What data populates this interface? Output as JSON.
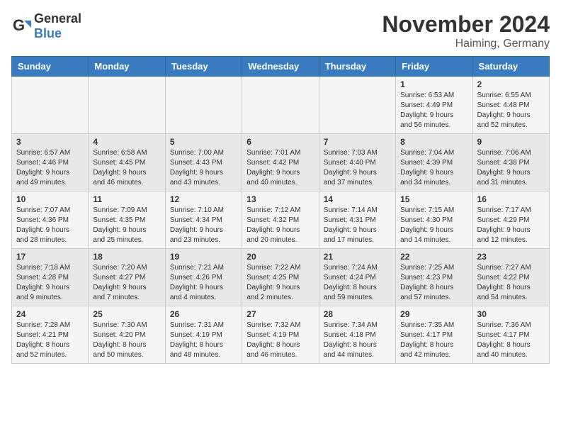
{
  "header": {
    "logo_general": "General",
    "logo_blue": "Blue",
    "month_title": "November 2024",
    "location": "Haiming, Germany"
  },
  "days_of_week": [
    "Sunday",
    "Monday",
    "Tuesday",
    "Wednesday",
    "Thursday",
    "Friday",
    "Saturday"
  ],
  "weeks": [
    [
      {
        "day": "",
        "info": ""
      },
      {
        "day": "",
        "info": ""
      },
      {
        "day": "",
        "info": ""
      },
      {
        "day": "",
        "info": ""
      },
      {
        "day": "",
        "info": ""
      },
      {
        "day": "1",
        "info": "Sunrise: 6:53 AM\nSunset: 4:49 PM\nDaylight: 9 hours\nand 56 minutes."
      },
      {
        "day": "2",
        "info": "Sunrise: 6:55 AM\nSunset: 4:48 PM\nDaylight: 9 hours\nand 52 minutes."
      }
    ],
    [
      {
        "day": "3",
        "info": "Sunrise: 6:57 AM\nSunset: 4:46 PM\nDaylight: 9 hours\nand 49 minutes."
      },
      {
        "day": "4",
        "info": "Sunrise: 6:58 AM\nSunset: 4:45 PM\nDaylight: 9 hours\nand 46 minutes."
      },
      {
        "day": "5",
        "info": "Sunrise: 7:00 AM\nSunset: 4:43 PM\nDaylight: 9 hours\nand 43 minutes."
      },
      {
        "day": "6",
        "info": "Sunrise: 7:01 AM\nSunset: 4:42 PM\nDaylight: 9 hours\nand 40 minutes."
      },
      {
        "day": "7",
        "info": "Sunrise: 7:03 AM\nSunset: 4:40 PM\nDaylight: 9 hours\nand 37 minutes."
      },
      {
        "day": "8",
        "info": "Sunrise: 7:04 AM\nSunset: 4:39 PM\nDaylight: 9 hours\nand 34 minutes."
      },
      {
        "day": "9",
        "info": "Sunrise: 7:06 AM\nSunset: 4:38 PM\nDaylight: 9 hours\nand 31 minutes."
      }
    ],
    [
      {
        "day": "10",
        "info": "Sunrise: 7:07 AM\nSunset: 4:36 PM\nDaylight: 9 hours\nand 28 minutes."
      },
      {
        "day": "11",
        "info": "Sunrise: 7:09 AM\nSunset: 4:35 PM\nDaylight: 9 hours\nand 25 minutes."
      },
      {
        "day": "12",
        "info": "Sunrise: 7:10 AM\nSunset: 4:34 PM\nDaylight: 9 hours\nand 23 minutes."
      },
      {
        "day": "13",
        "info": "Sunrise: 7:12 AM\nSunset: 4:32 PM\nDaylight: 9 hours\nand 20 minutes."
      },
      {
        "day": "14",
        "info": "Sunrise: 7:14 AM\nSunset: 4:31 PM\nDaylight: 9 hours\nand 17 minutes."
      },
      {
        "day": "15",
        "info": "Sunrise: 7:15 AM\nSunset: 4:30 PM\nDaylight: 9 hours\nand 14 minutes."
      },
      {
        "day": "16",
        "info": "Sunrise: 7:17 AM\nSunset: 4:29 PM\nDaylight: 9 hours\nand 12 minutes."
      }
    ],
    [
      {
        "day": "17",
        "info": "Sunrise: 7:18 AM\nSunset: 4:28 PM\nDaylight: 9 hours\nand 9 minutes."
      },
      {
        "day": "18",
        "info": "Sunrise: 7:20 AM\nSunset: 4:27 PM\nDaylight: 9 hours\nand 7 minutes."
      },
      {
        "day": "19",
        "info": "Sunrise: 7:21 AM\nSunset: 4:26 PM\nDaylight: 9 hours\nand 4 minutes."
      },
      {
        "day": "20",
        "info": "Sunrise: 7:22 AM\nSunset: 4:25 PM\nDaylight: 9 hours\nand 2 minutes."
      },
      {
        "day": "21",
        "info": "Sunrise: 7:24 AM\nSunset: 4:24 PM\nDaylight: 8 hours\nand 59 minutes."
      },
      {
        "day": "22",
        "info": "Sunrise: 7:25 AM\nSunset: 4:23 PM\nDaylight: 8 hours\nand 57 minutes."
      },
      {
        "day": "23",
        "info": "Sunrise: 7:27 AM\nSunset: 4:22 PM\nDaylight: 8 hours\nand 54 minutes."
      }
    ],
    [
      {
        "day": "24",
        "info": "Sunrise: 7:28 AM\nSunset: 4:21 PM\nDaylight: 8 hours\nand 52 minutes."
      },
      {
        "day": "25",
        "info": "Sunrise: 7:30 AM\nSunset: 4:20 PM\nDaylight: 8 hours\nand 50 minutes."
      },
      {
        "day": "26",
        "info": "Sunrise: 7:31 AM\nSunset: 4:19 PM\nDaylight: 8 hours\nand 48 minutes."
      },
      {
        "day": "27",
        "info": "Sunrise: 7:32 AM\nSunset: 4:19 PM\nDaylight: 8 hours\nand 46 minutes."
      },
      {
        "day": "28",
        "info": "Sunrise: 7:34 AM\nSunset: 4:18 PM\nDaylight: 8 hours\nand 44 minutes."
      },
      {
        "day": "29",
        "info": "Sunrise: 7:35 AM\nSunset: 4:17 PM\nDaylight: 8 hours\nand 42 minutes."
      },
      {
        "day": "30",
        "info": "Sunrise: 7:36 AM\nSunset: 4:17 PM\nDaylight: 8 hours\nand 40 minutes."
      }
    ]
  ]
}
